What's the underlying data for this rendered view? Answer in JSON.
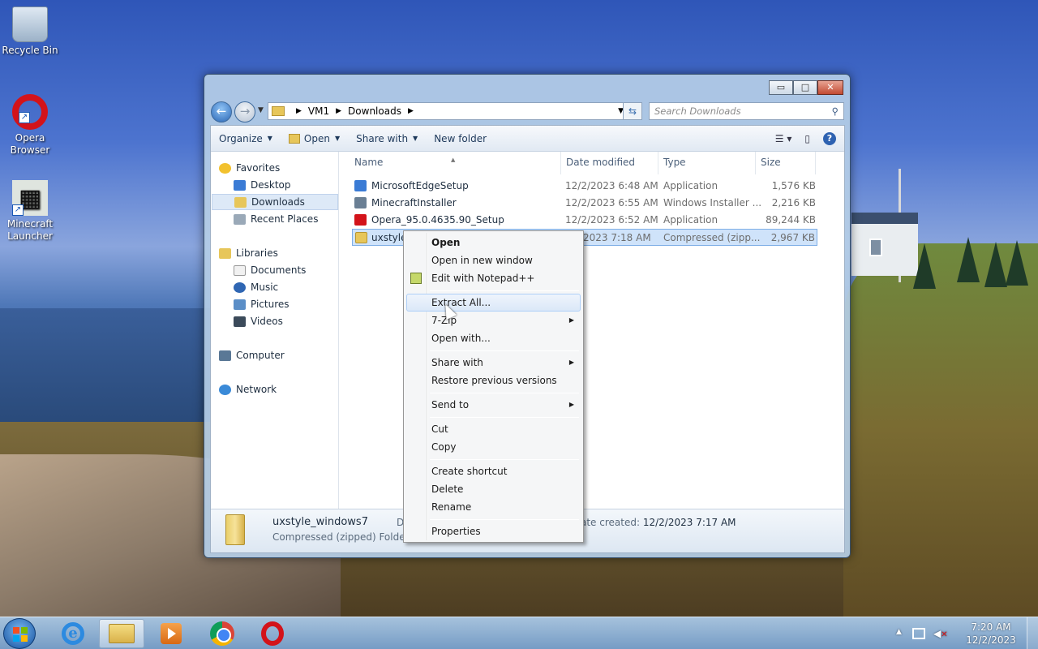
{
  "desktop": {
    "icons": [
      {
        "label": "Recycle Bin"
      },
      {
        "label": "Opera Browser"
      },
      {
        "label": "Minecraft Launcher"
      }
    ]
  },
  "window": {
    "caption_buttons": {
      "minimize": "▭",
      "maximize": "□",
      "close": "✕"
    },
    "breadcrumb": [
      "VM1",
      "Downloads"
    ],
    "search_placeholder": "Search Downloads",
    "toolbar": {
      "organize": "Organize",
      "open": "Open",
      "share_with": "Share with",
      "new_folder": "New folder"
    },
    "nav": {
      "favorites": "Favorites",
      "desktop": "Desktop",
      "downloads": "Downloads",
      "recent_places": "Recent Places",
      "libraries": "Libraries",
      "documents": "Documents",
      "music": "Music",
      "pictures": "Pictures",
      "videos": "Videos",
      "computer": "Computer",
      "network": "Network"
    },
    "columns": {
      "name": "Name",
      "date_modified": "Date modified",
      "type": "Type",
      "size": "Size"
    },
    "files": [
      {
        "name": "MicrosoftEdgeSetup",
        "date": "12/2/2023 6:48 AM",
        "type": "Application",
        "size": "1,576 KB",
        "icon_color": "#3a7bd5"
      },
      {
        "name": "MinecraftInstaller",
        "date": "12/2/2023 6:55 AM",
        "type": "Windows Installer ...",
        "size": "2,216 KB",
        "icon_color": "#6a7f94"
      },
      {
        "name": "Opera_95.0.4635.90_Setup",
        "date": "12/2/2023 6:52 AM",
        "type": "Application",
        "size": "89,244 KB",
        "icon_color": "#d3131a"
      },
      {
        "name": "uxstyle_",
        "date": "2023 7:18 AM",
        "type": "Compressed (zipp...",
        "size": "2,967 KB",
        "icon_color": "#e7c65a"
      }
    ],
    "details": {
      "name": "uxstyle_windows7",
      "type": "Compressed (zipped) Folder",
      "truncated_label": "D",
      "created_label": "ate created:",
      "created_value": "12/2/2023 7:17 AM"
    }
  },
  "context_menu": {
    "items": [
      "Open",
      "Open in new window",
      "Edit with Notepad++",
      "Extract All...",
      "7-Zip",
      "Open with...",
      "Share with",
      "Restore previous versions",
      "Send to",
      "Cut",
      "Copy",
      "Create shortcut",
      "Delete",
      "Rename",
      "Properties"
    ],
    "highlighted": "Extract All..."
  },
  "taskbar": {
    "clock_time": "7:20 AM",
    "clock_date": "12/2/2023"
  }
}
